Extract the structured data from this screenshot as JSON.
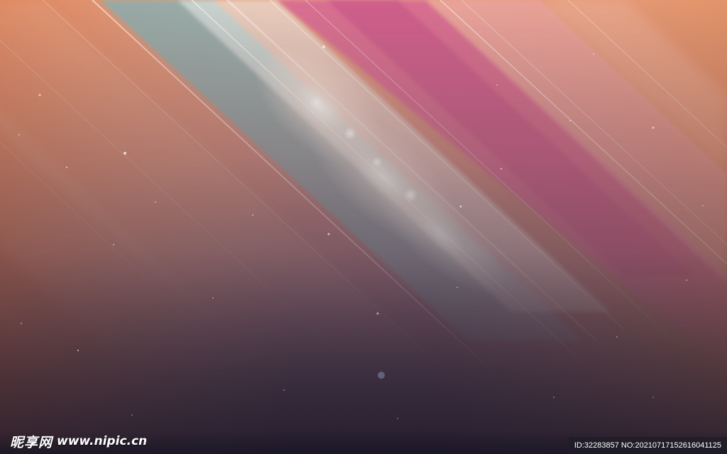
{
  "image": {
    "subject": "abstract-diagonal-light-streaks",
    "palette": {
      "top_left": "#e08a5c",
      "pink_stripe": "#d9659a",
      "teal_stripe": "#8fb8b8",
      "glow": "#fff6ec",
      "bottom": "#2a2436",
      "mid": "#9e6f7e"
    }
  },
  "watermark": {
    "brand": "昵享网",
    "url": "www.nipic.cn",
    "id_text": "ID:32283857 NO:20210717152616041125"
  }
}
